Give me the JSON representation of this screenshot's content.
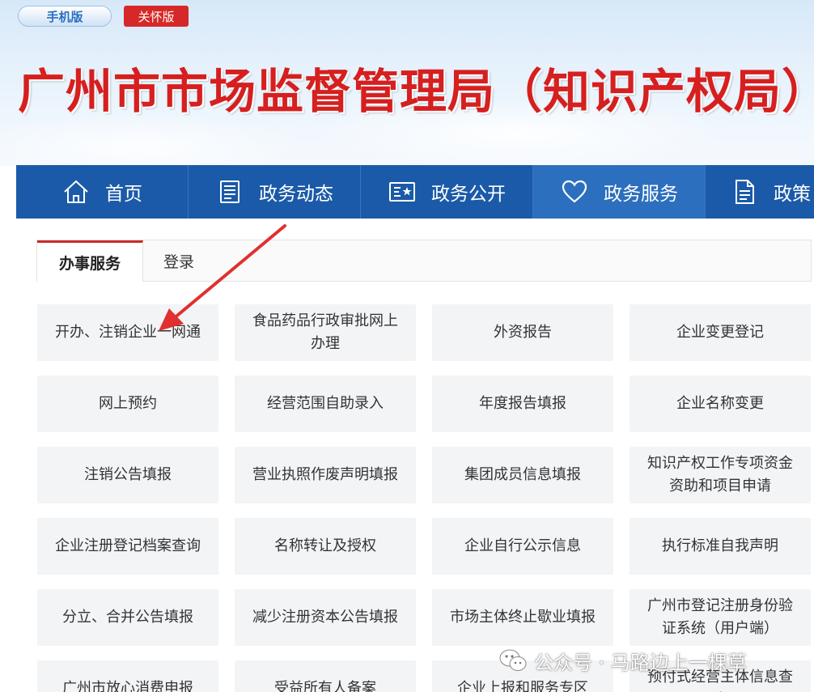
{
  "header": {
    "mobile_version": "手机版",
    "care_version": "关怀版",
    "site_title": "广州市市场监督管理局（知识产权局）"
  },
  "nav": {
    "items": [
      {
        "label": "首页",
        "icon": "home-icon"
      },
      {
        "label": "政务动态",
        "icon": "news-icon"
      },
      {
        "label": "政务公开",
        "icon": "disclosure-icon"
      },
      {
        "label": "政务服务",
        "icon": "heart-icon"
      },
      {
        "label": "政策",
        "icon": "document-icon"
      }
    ],
    "active_index": 3
  },
  "tabs": [
    {
      "label": "办事服务"
    },
    {
      "label": "登录"
    }
  ],
  "services": [
    [
      "开办、注销企业一网通",
      "食品药品行政审批网上办理",
      "外资报告",
      "企业变更登记"
    ],
    [
      "网上预约",
      "经营范围自助录入",
      "年度报告填报",
      "企业名称变更"
    ],
    [
      "注销公告填报",
      "营业执照作废声明填报",
      "集团成员信息填报",
      "知识产权工作专项资金资助和项目申请"
    ],
    [
      "企业注册登记档案查询",
      "名称转让及授权",
      "企业自行公示信息",
      "执行标准自我声明"
    ],
    [
      "分立、合并公告填报",
      "减少注册资本公告填报",
      "市场主体终止歇业填报",
      "广州市登记注册身份验证系统（用户端）"
    ],
    [
      "广州市放心消费申报",
      "受益所有人备案",
      "企业上报和服务专区",
      "预付式经营主体信息查询"
    ]
  ],
  "watermark": {
    "text": "公众号 · 马路边上一棵草",
    "icon": "wechat-icon"
  },
  "colors": {
    "title_red": "#d61f1f",
    "nav_blue": "#1b5aa8",
    "nav_active": "#2d6fbf",
    "tab_accent": "#c92b2b",
    "arrow_red": "#e03030"
  }
}
